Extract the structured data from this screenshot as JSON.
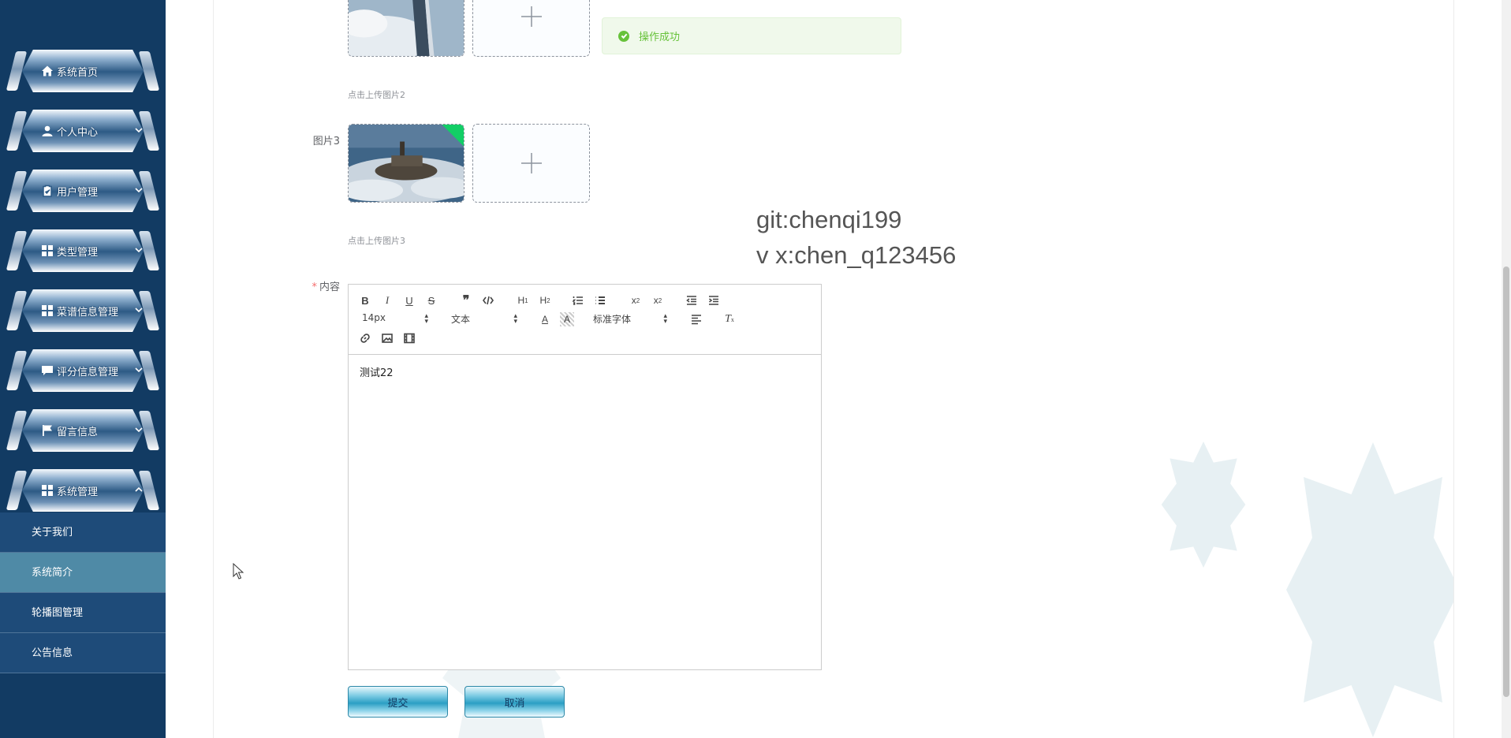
{
  "sidebar": {
    "menu": [
      {
        "label": "系统首页",
        "icon": "home-icon",
        "has_arrow": false
      },
      {
        "label": "个人中心",
        "icon": "user-icon",
        "has_arrow": true
      },
      {
        "label": "用户管理",
        "icon": "clipboard-icon",
        "has_arrow": true
      },
      {
        "label": "类型管理",
        "icon": "grid-icon",
        "has_arrow": true
      },
      {
        "label": "菜谱信息管理",
        "icon": "grid-icon",
        "has_arrow": true
      },
      {
        "label": "评分信息管理",
        "icon": "chat-icon",
        "has_arrow": true
      },
      {
        "label": "留言信息",
        "icon": "flag-icon",
        "has_arrow": true
      },
      {
        "label": "系统管理",
        "icon": "grid-icon",
        "has_arrow": true,
        "expanded": true
      }
    ],
    "submenu": [
      {
        "label": "关于我们",
        "active": false
      },
      {
        "label": "系统简介",
        "active": true
      },
      {
        "label": "轮播图管理",
        "active": false
      },
      {
        "label": "公告信息",
        "active": false
      }
    ]
  },
  "toast": {
    "message": "操作成功"
  },
  "form": {
    "image2_hint": "点击上传图片2",
    "image3_label": "图片3",
    "image3_hint": "点击上传图片3",
    "content_label": "内容",
    "content_required_mark": "*"
  },
  "watermark": {
    "line1": "git:chenqi199",
    "line2": "v x:chen_q123456"
  },
  "editor": {
    "font_size": "14px",
    "header_picker": "文本",
    "font_family": "标准字体",
    "content": "测试22"
  },
  "buttons": {
    "submit": "提交",
    "cancel": "取消"
  },
  "colors": {
    "sidebar_bg": "#123b63",
    "submenu_active": "#4f8aa6",
    "toast_green": "#67c23a"
  }
}
